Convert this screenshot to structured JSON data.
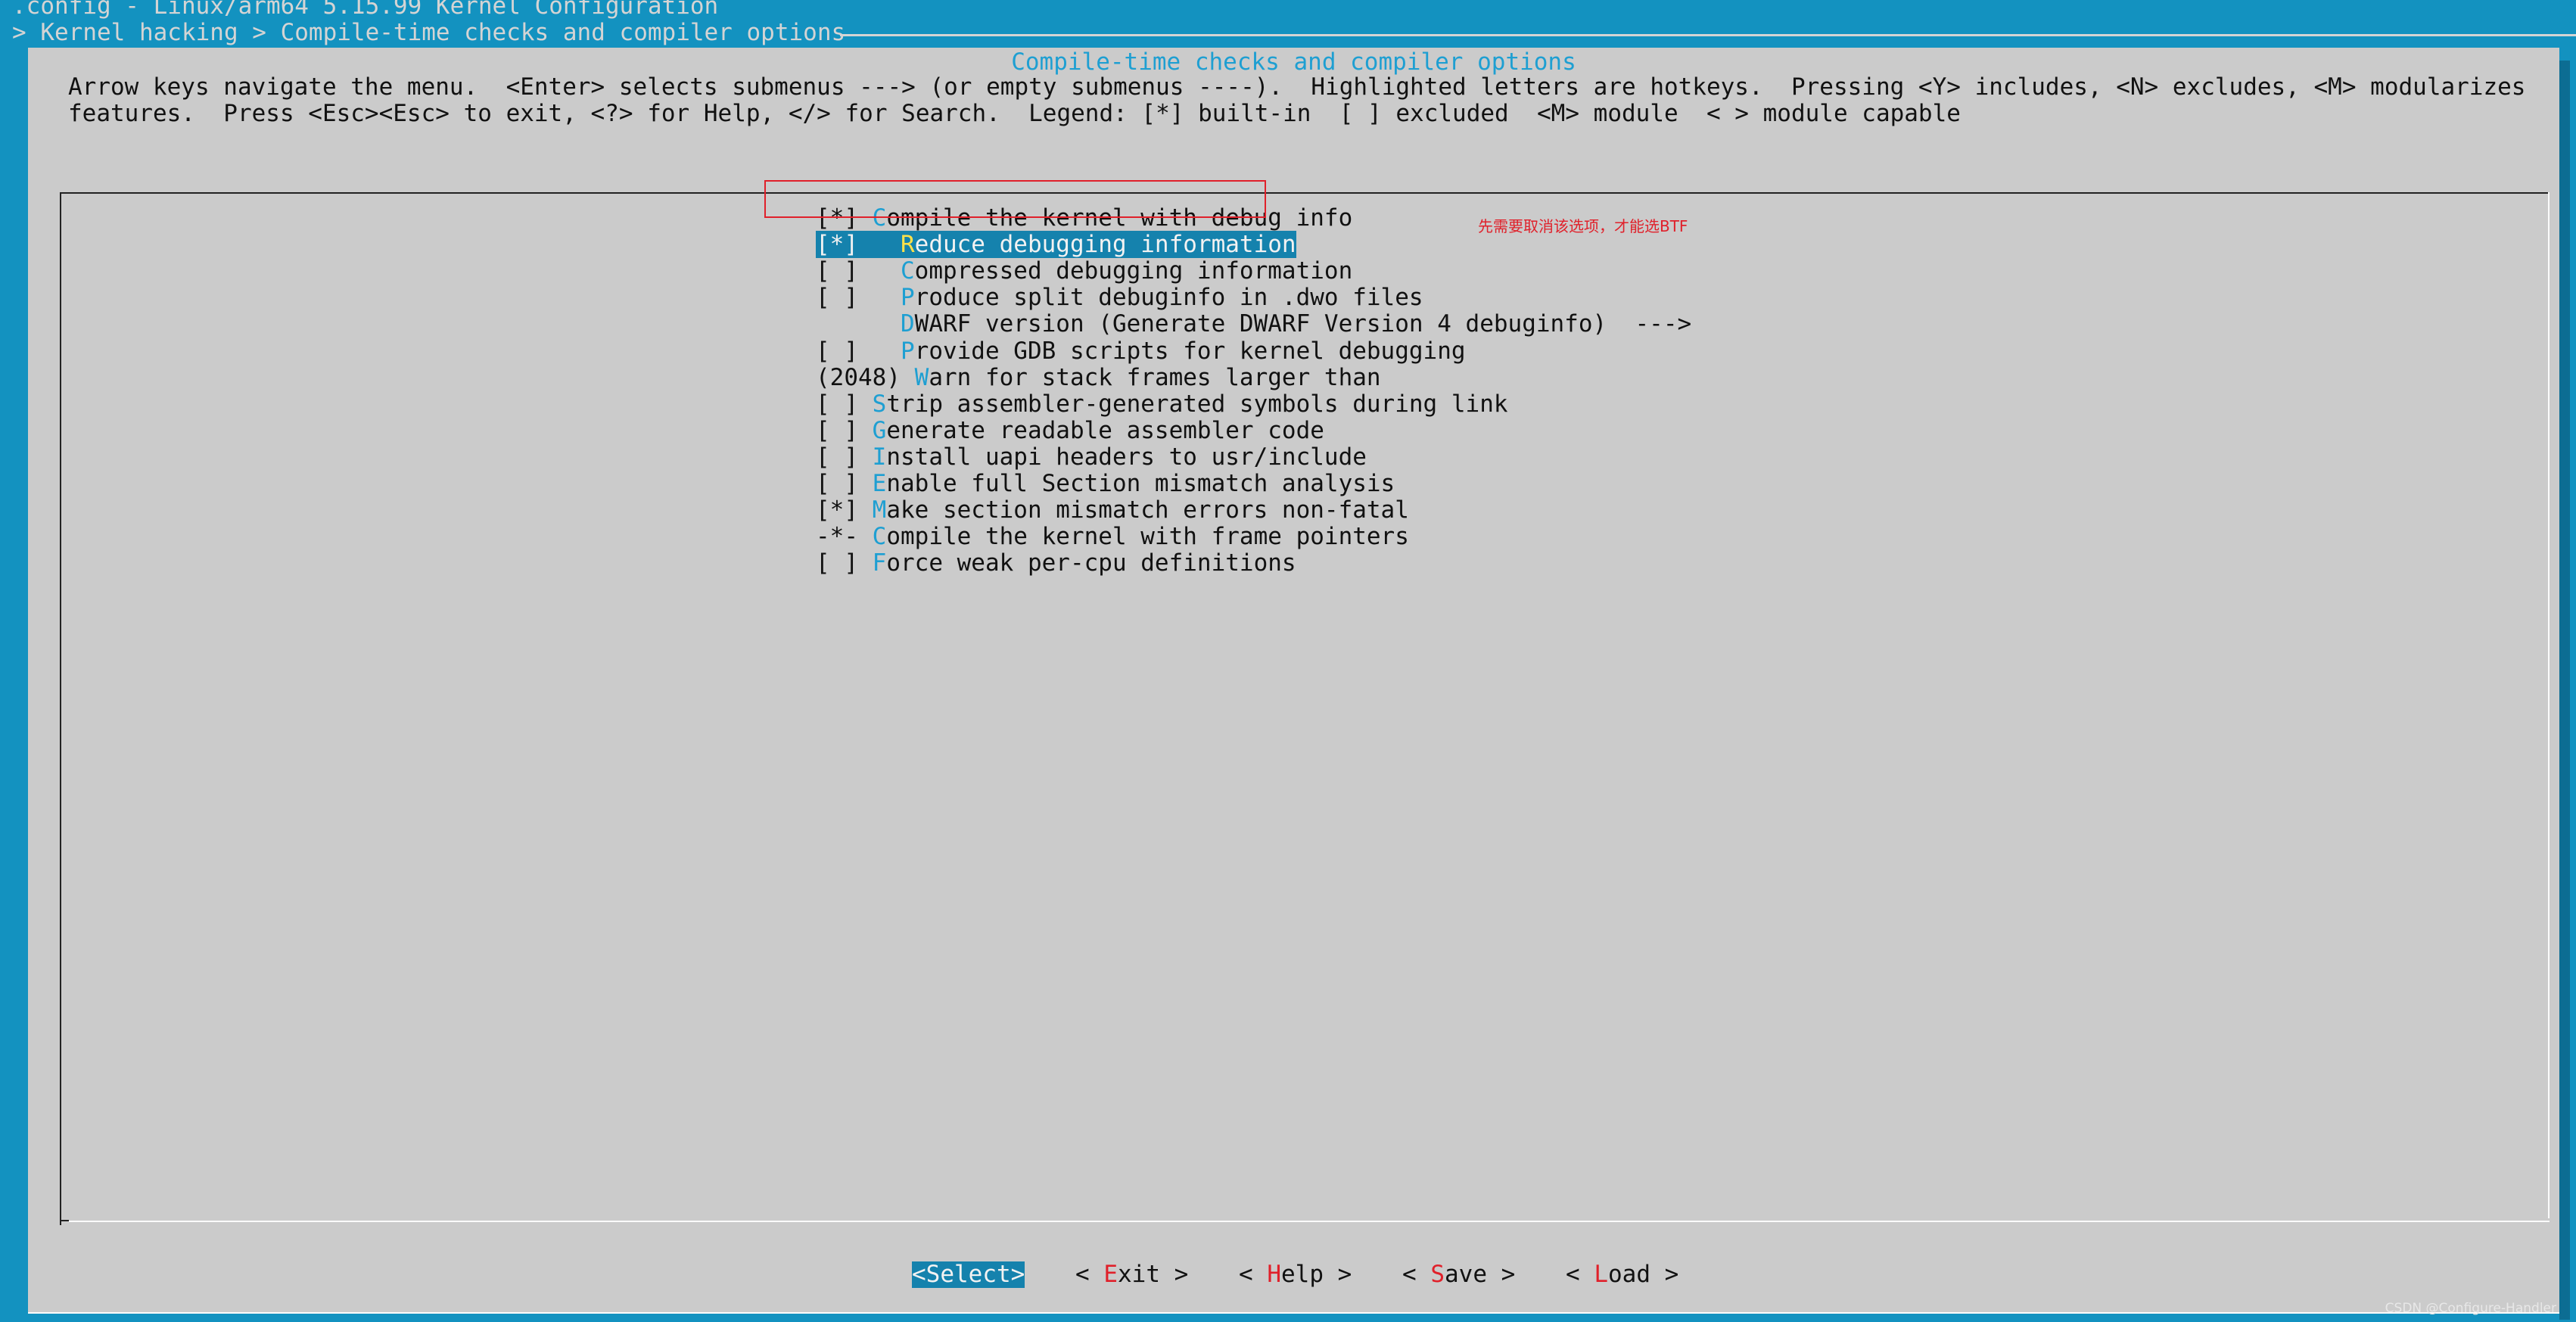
{
  "window": {
    "title": ".config - Linux/arm64 5.15.99 Kernel Configuration",
    "breadcrumb": "> Kernel hacking > Compile-time checks and compiler options"
  },
  "dialog": {
    "title": "Compile-time checks and compiler options",
    "help_line1": "Arrow keys navigate the menu.  <Enter> selects submenus ---> (or empty submenus ----).  Highlighted letters are hotkeys.  Pressing <Y> includes, <N> excludes, <M> modularizes",
    "help_line2": "features.  Press <Esc><Esc> to exit, <?> for Help, </> for Search.  Legend: [*] built-in  [ ] excluded  <M> module  < > module capable"
  },
  "menu": {
    "items": [
      {
        "prefix": "[*] ",
        "hotkey": "C",
        "rest": "ompile the kernel with debug info",
        "selected": false
      },
      {
        "prefix": "[*]   ",
        "hotkey": "R",
        "rest": "educe debugging information",
        "selected": true
      },
      {
        "prefix": "[ ]   ",
        "hotkey": "C",
        "rest": "ompressed debugging information",
        "selected": false
      },
      {
        "prefix": "[ ]   ",
        "hotkey": "P",
        "rest": "roduce split debuginfo in .dwo files",
        "selected": false
      },
      {
        "prefix": "      ",
        "hotkey": "D",
        "rest": "WARF version (Generate DWARF Version 4 debuginfo)  --->",
        "selected": false
      },
      {
        "prefix": "[ ]   ",
        "hotkey": "P",
        "rest": "rovide GDB scripts for kernel debugging",
        "selected": false
      },
      {
        "prefix": "(2048) ",
        "hotkey": "W",
        "rest": "arn for stack frames larger than",
        "selected": false
      },
      {
        "prefix": "[ ] ",
        "hotkey": "S",
        "rest": "trip assembler-generated symbols during link",
        "selected": false
      },
      {
        "prefix": "[ ] ",
        "hotkey": "G",
        "rest": "enerate readable assembler code",
        "selected": false
      },
      {
        "prefix": "[ ] ",
        "hotkey": "I",
        "rest": "nstall uapi headers to usr/include",
        "selected": false
      },
      {
        "prefix": "[ ] ",
        "hotkey": "E",
        "rest": "nable full Section mismatch analysis",
        "selected": false
      },
      {
        "prefix": "[*] ",
        "hotkey": "M",
        "rest": "ake section mismatch errors non-fatal",
        "selected": false
      },
      {
        "prefix": "-*- ",
        "hotkey": "C",
        "rest": "ompile the kernel with frame pointers",
        "selected": false
      },
      {
        "prefix": "[ ] ",
        "hotkey": "F",
        "rest": "orce weak per-cpu definitions",
        "selected": false
      }
    ]
  },
  "annotation": {
    "note": "先需要取消该选项，才能选BTF",
    "color": "#e0202a"
  },
  "buttons": [
    {
      "open": "<",
      "hotkey": "S",
      "rest": "elect",
      "close": ">",
      "active": true
    },
    {
      "open": "< ",
      "hotkey": "E",
      "rest": "xit",
      "close": " >",
      "active": false
    },
    {
      "open": "< ",
      "hotkey": "H",
      "rest": "elp",
      "close": " >",
      "active": false
    },
    {
      "open": "< ",
      "hotkey": "S",
      "rest": "ave",
      "close": " >",
      "active": false
    },
    {
      "open": "< ",
      "hotkey": "L",
      "rest": "oad",
      "close": " >",
      "active": false
    }
  ],
  "watermark": "CSDN @Configure-Handler",
  "colors": {
    "background": "#1392c0",
    "dialog": "#cbcbcb",
    "hotkey": "#1e9fd2",
    "selection": "#1582ad",
    "selected_hotkey": "#ffe14a",
    "button_hotkey": "#e0202a"
  }
}
